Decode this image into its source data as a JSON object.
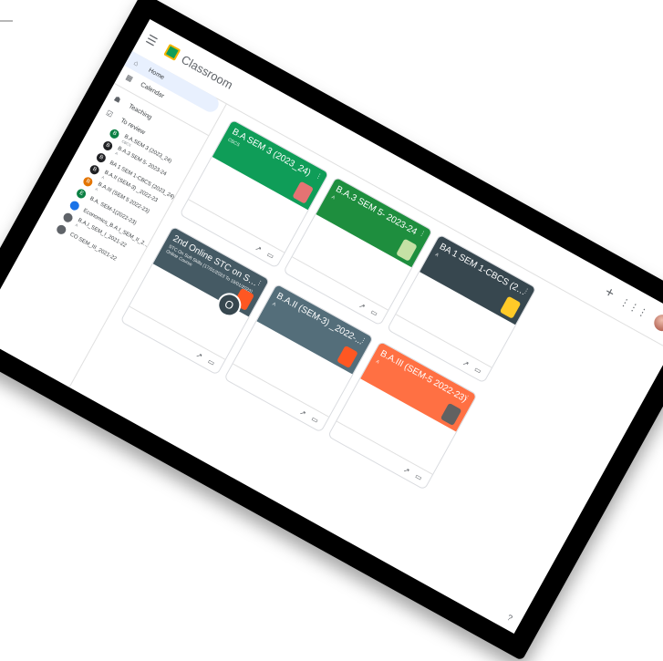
{
  "app": {
    "brand": "Classroom"
  },
  "topbar": {
    "menu_icon": "hamburger-menu-icon",
    "add_icon": "plus-icon",
    "apps_icon": "apps-grid-icon"
  },
  "nav": {
    "home": "Home",
    "calendar": "Calendar",
    "teaching": "Teaching",
    "to_review": "To review"
  },
  "classes": [
    {
      "letter": "B",
      "name": "B.A.SEM 3 (2023_24)",
      "sub": "CBCS",
      "color": "#0b8043"
    },
    {
      "letter": "B",
      "name": "B.A.3 SEM 5- 2023-24",
      "sub": "A",
      "color": "#202124"
    },
    {
      "letter": "B",
      "name": "BA 1 SEM 1-CBCS (2023_24)",
      "sub": "",
      "color": "#202124"
    },
    {
      "letter": "B",
      "name": "B.A.II (SEM-3) _2022-23",
      "sub": "A",
      "color": "#202124"
    },
    {
      "letter": "B",
      "name": "B.A.III (SEM 5 2022-23)",
      "sub": "A",
      "color": "#e37400"
    },
    {
      "letter": "E",
      "name": "B.A. SEM-1(2022-23)",
      "sub": "",
      "color": "#0b8043"
    },
    {
      "letter": "",
      "name": "Economics_B.A.I_SEM_II_2...",
      "sub": "",
      "color": "#1a73e8"
    },
    {
      "letter": "",
      "name": "B.A.I_SEM_I_2021-22",
      "sub": "A",
      "color": "#5f6368"
    },
    {
      "letter": "",
      "name": "CO SEM_III_2021-22",
      "sub": "",
      "color": "#5f6368"
    }
  ],
  "cards": [
    {
      "title": "B.A SEM 3 (2023_24)",
      "sub": "CBCS",
      "desc": "",
      "color": "#0f9d58"
    },
    {
      "title": "B.A.3 SEM 5- 2023-24",
      "sub": "A",
      "desc": "",
      "color": "#1e8e3e"
    },
    {
      "title": "BA 1 SEM 1-CBCS (20...",
      "sub": "A",
      "desc": "",
      "color": "#37474f"
    },
    {
      "title": "2nd Online STC on So...",
      "sub": "STC On Soft Skills (17/01/2023 To 19/01/2023)",
      "desc": "Online Course",
      "color": "#455a64",
      "avatar_letter": "O"
    },
    {
      "title": "B.A.II (SEM-3) _2022-...",
      "sub": "A",
      "desc": "",
      "color": "#546e7a"
    },
    {
      "title": "B.A.III (SEM-5 2022-23)",
      "sub": "A",
      "desc": "",
      "color": "#ff7043"
    }
  ],
  "colors": {
    "accent": "#1a73e8",
    "bezel": "#000000"
  }
}
